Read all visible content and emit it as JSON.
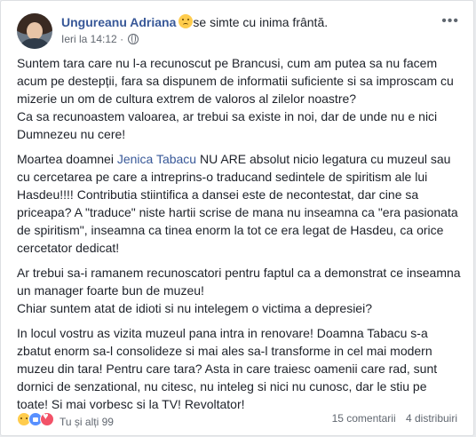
{
  "post": {
    "author": "Ungureanu Adriana",
    "feeling": "se simte cu inima frântă.",
    "feeling_icon": "sad-emoji-icon",
    "time": "Ieri la 14:12",
    "separator": "·",
    "privacy_icon": "globe-icon",
    "more_menu": "•••"
  },
  "body": {
    "p1": "Suntem tara care nu l-a recunoscut pe Brancusi, cum am putea sa nu facem acum pe destepții, fara sa dispunem de informatii suficiente si sa improscam cu mizerie un om de cultura extrem de valoros al zilelor noastre?",
    "p1b": "Ca sa recunoastem valoarea, ar trebui sa existe in noi, dar de unde nu e nici Dumnezeu nu cere!",
    "p2_pre": "Moartea doamnei ",
    "p2_mention": "Jenica Tabacu",
    "p2_post": " NU ARE absolut nicio legatura cu muzeul sau cu cercetarea pe care a intreprins-o traducand sedintele de spiritism ale lui Hasdeu!!!! Contributia stiintifica a dansei este de necontestat, dar cine sa priceapa? A \"traduce\" niste hartii scrise de mana nu inseamna ca \"era pasionata de spiritism\", inseamna ca tinea enorm la tot ce era legat de Hasdeu, ca orice cercetator dedicat!",
    "p3": "Ar trebui sa-i ramanem recunoscatori pentru faptul ca a demonstrat ce inseamna un manager foarte bun de muzeu!",
    "p3b": "Chiar suntem atat de idioti si nu intelegem o victima a depresiei?",
    "p4": "In locul vostru as vizita muzeul pana intra in renovare! Doamna Tabacu s-a zbatut enorm sa-l consolideze si mai ales sa-l transforme in cel mai modern muzeu din tara! Pentru care tara? Asta in care traiesc oamenii care rad, sunt dornici de senzational, nu citesc, nu inteleg si nici nu cunosc, dar le stiu pe toate! Si mai vorbesc si la TV! Revoltator!"
  },
  "footer": {
    "reaction_icons": [
      "sad-reaction-icon",
      "like-reaction-icon",
      "love-reaction-icon"
    ],
    "reaction_text": "Tu și alți 99",
    "comments": "15 comentarii",
    "shares": "4 distribuiri"
  },
  "colors": {
    "link": "#385898",
    "text": "#1d2129",
    "meta": "#616770"
  }
}
